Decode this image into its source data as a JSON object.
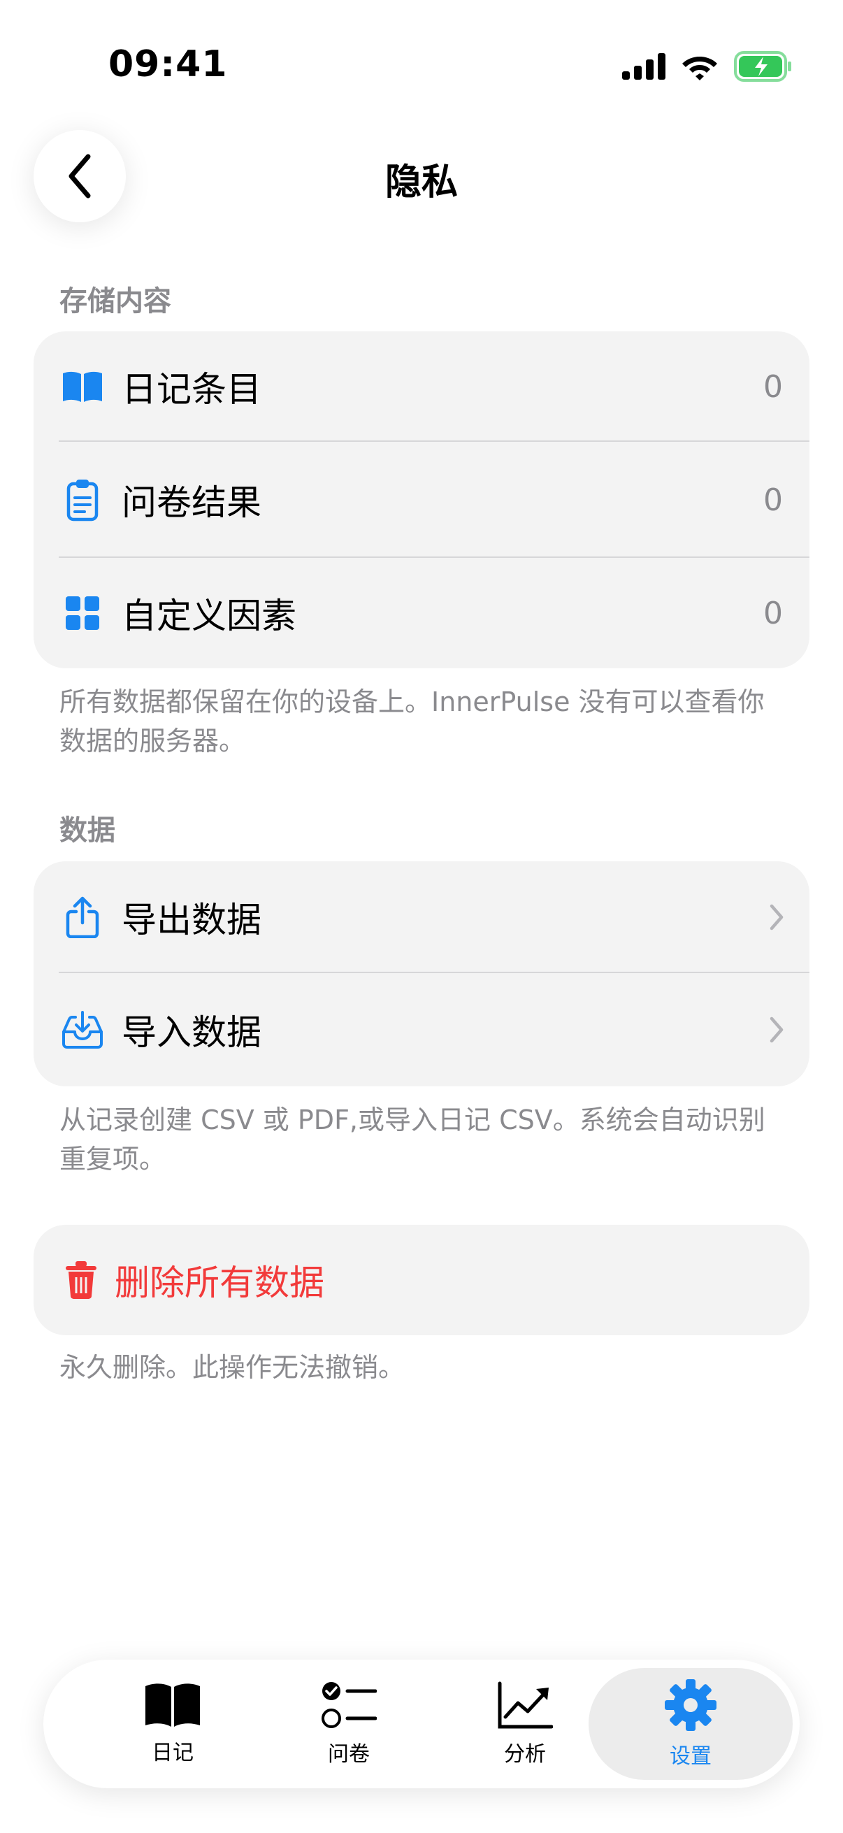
{
  "status_bar": {
    "time": "09:41"
  },
  "nav": {
    "title": "隐私"
  },
  "storage": {
    "header": "存储内容",
    "items": [
      {
        "label": "日记条目",
        "value": "0",
        "icon": "book-icon"
      },
      {
        "label": "问卷结果",
        "value": "0",
        "icon": "clipboard-icon"
      },
      {
        "label": "自定义因素",
        "value": "0",
        "icon": "grid-icon"
      }
    ],
    "footnote": "所有数据都保留在你的设备上。InnerPulse 没有可以查看你数据的服务器。"
  },
  "data": {
    "header": "数据",
    "items": [
      {
        "label": "导出数据",
        "icon": "share-icon"
      },
      {
        "label": "导入数据",
        "icon": "tray-download-icon"
      }
    ],
    "footnote": "从记录创建 CSV 或 PDF,或导入日记 CSV。系统会自动识别重复项。"
  },
  "danger": {
    "label": "删除所有数据",
    "icon": "trash-icon",
    "footnote": "永久删除。此操作无法撤销。"
  },
  "tabs": [
    {
      "label": "日记",
      "icon": "book-icon"
    },
    {
      "label": "问卷",
      "icon": "checklist-icon"
    },
    {
      "label": "分析",
      "icon": "chart-line-icon"
    },
    {
      "label": "设置",
      "icon": "gear-icon",
      "active": true
    }
  ],
  "colors": {
    "accent": "#1a86f0",
    "danger": "#f23a3a",
    "battery": "#34c759"
  }
}
